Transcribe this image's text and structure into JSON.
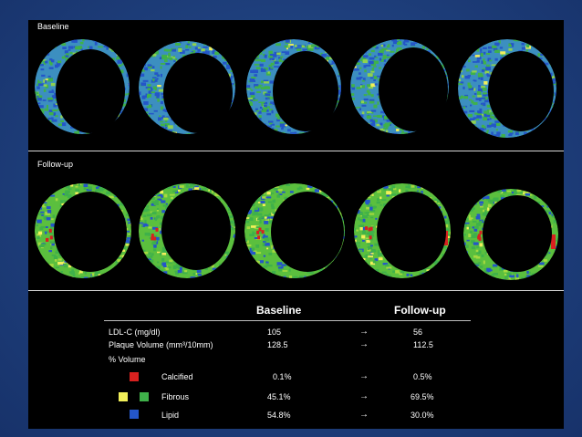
{
  "sections": {
    "baseline_label": "Baseline",
    "followup_label": "Follow-up"
  },
  "colors": {
    "calcified": "#d8211f",
    "fibrous_yellow": "#f2f05a",
    "fibrous_green": "#3fb14a",
    "lipid": "#2456c8",
    "panel_bg": "#000000"
  },
  "table": {
    "col_baseline": "Baseline",
    "col_followup": "Follow-up",
    "rows": [
      {
        "label": "LDL-C  (mg/dl)",
        "baseline": "105",
        "arrow": "→",
        "followup": "56"
      },
      {
        "label": "Plaque Volume (mm³/10mm)",
        "baseline": "128.5",
        "arrow": "→",
        "followup": "112.5"
      }
    ],
    "volume_heading": "% Volume",
    "volume_rows": [
      {
        "label": "Calcified",
        "baseline": "0.1%",
        "arrow": "→",
        "followup": "0.5%"
      },
      {
        "label": "Fibrous",
        "baseline": "45.1%",
        "arrow": "→",
        "followup": "69.5%"
      },
      {
        "label": "Lipid",
        "baseline": "54.8%",
        "arrow": "→",
        "followup": "30.0%"
      }
    ]
  }
}
